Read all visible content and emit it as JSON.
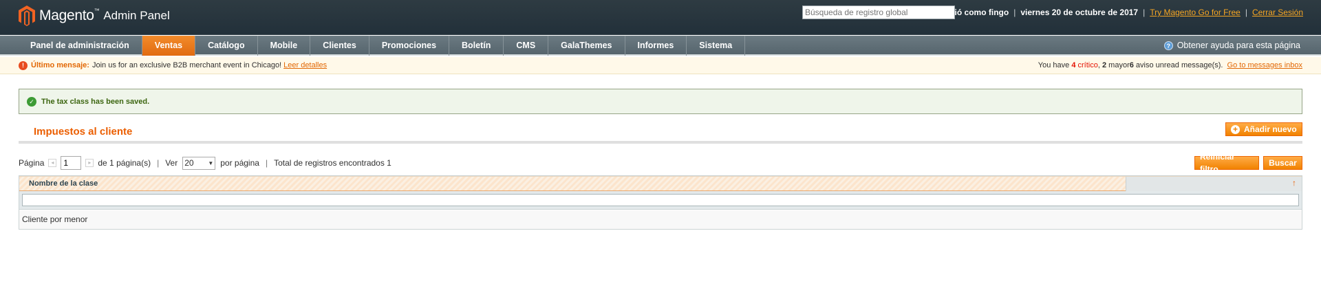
{
  "header": {
    "logo_name": "Magento",
    "logo_tm": "™",
    "logo_sub": "Admin Panel",
    "search_placeholder": "Búsqueda de registro global",
    "logged_in": "Accedió como fingo",
    "date": "viernes 20 de octubre de 2017",
    "try_link": "Try Magento Go for Free",
    "logout_link": "Cerrar Sesión",
    "separator": "|"
  },
  "nav": {
    "items": [
      {
        "label": "Panel de administración"
      },
      {
        "label": "Ventas"
      },
      {
        "label": "Catálogo"
      },
      {
        "label": "Mobile"
      },
      {
        "label": "Clientes"
      },
      {
        "label": "Promociones"
      },
      {
        "label": "Boletín"
      },
      {
        "label": "CMS"
      },
      {
        "label": "GalaThemes"
      },
      {
        "label": "Informes"
      },
      {
        "label": "Sistema"
      }
    ],
    "active_index": 1,
    "help": "Obtener ayuda para esta página",
    "help_icon": "?"
  },
  "notice": {
    "icon": "!",
    "title": "Último mensaje:",
    "text": "Join us for an exclusive B2B merchant event in Chicago!",
    "link": "Leer detalles",
    "right_prefix": "You have",
    "critical_count": "4",
    "critical_label": "crítico",
    "major_count": "2",
    "major_label": "mayor",
    "notice_count": "6",
    "notice_label": "aviso unread message(s).",
    "inbox_link": "Go to messages inbox"
  },
  "success": {
    "icon": "✓",
    "text": "The tax class has been saved."
  },
  "content": {
    "title": "Impuestos al cliente",
    "add_button": "Añadir nuevo",
    "add_icon": "+",
    "reset_button": "Reiniciar filtro",
    "search_button": "Buscar"
  },
  "pager": {
    "page_label": "Página",
    "page_value": "1",
    "of_pages": "de 1 página(s)",
    "view_label": "Ver",
    "per_page_value": "20",
    "per_page_label": "por página",
    "total": "Total de registros encontrados 1",
    "prev_icon": "◂",
    "next_icon": "▸",
    "caret": "▼",
    "separator": "|"
  },
  "grid": {
    "column_header": "Nombre de la clase",
    "sort_icon": "↑",
    "rows": [
      {
        "name": "Cliente por menor"
      }
    ]
  }
}
